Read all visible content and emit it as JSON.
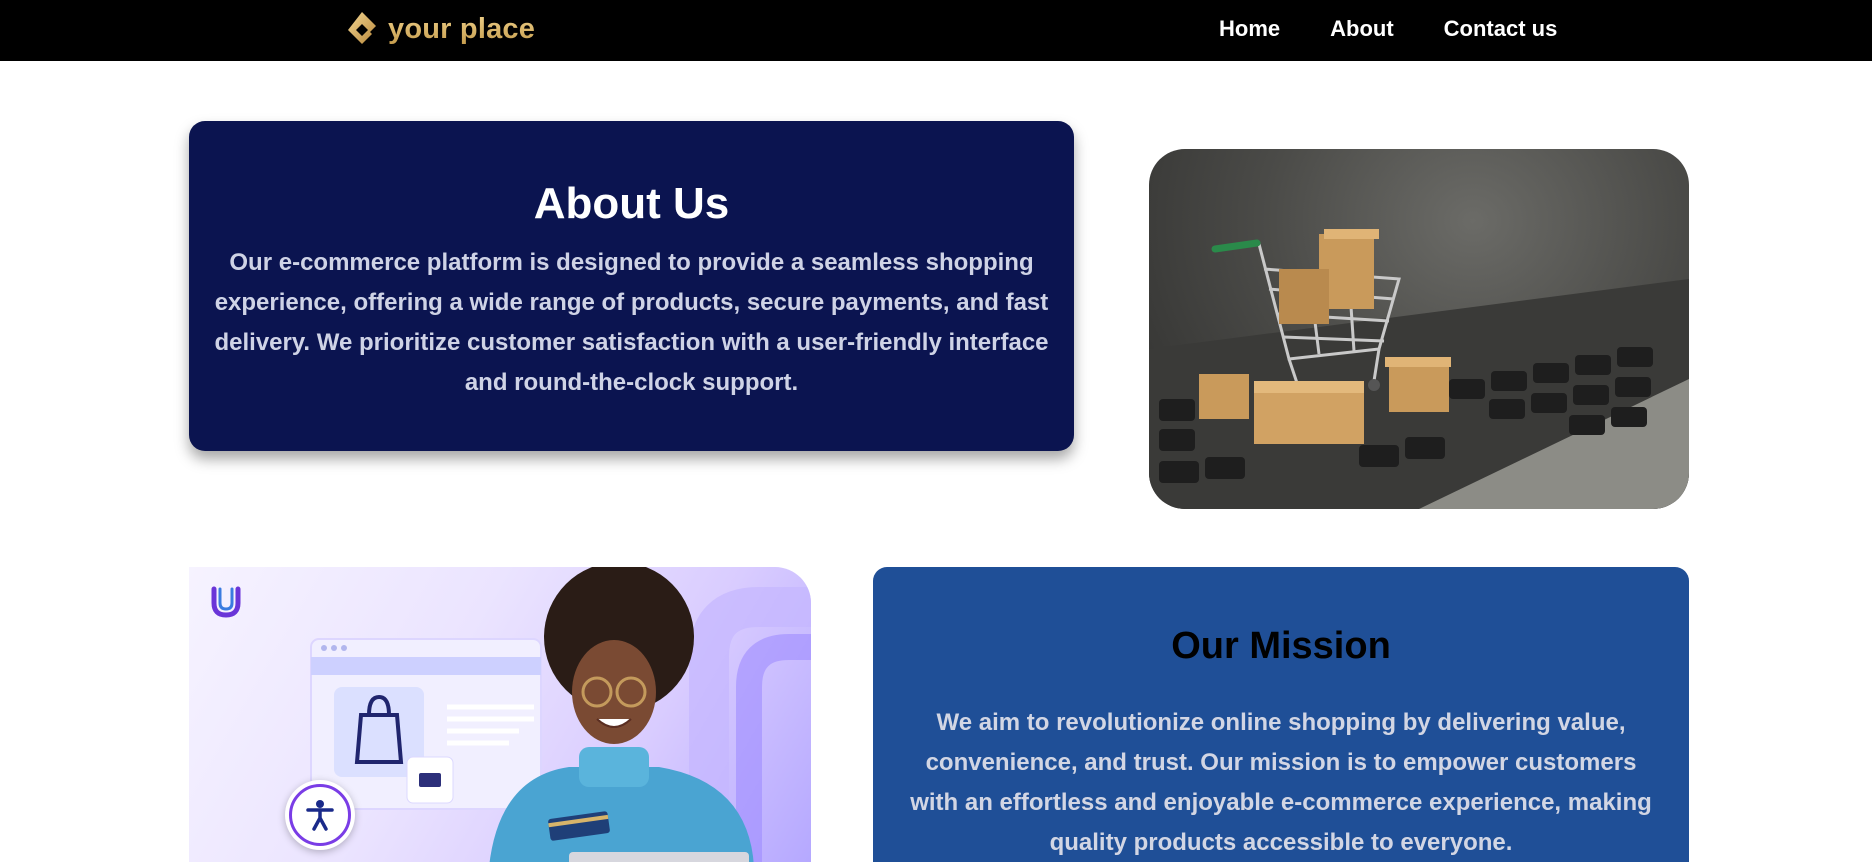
{
  "navbar": {
    "logo_text": "your place",
    "links": [
      {
        "label": "Home"
      },
      {
        "label": "About"
      },
      {
        "label": "Contact us"
      }
    ]
  },
  "about": {
    "title": "About Us",
    "body": "Our e-commerce platform is designed to provide a seamless shopping experience, offering a wide range of products, secure payments, and fast delivery. We prioritize customer satisfaction with a user-friendly interface and round-the-clock support."
  },
  "mission": {
    "title": "Our Mission",
    "body": "We aim to revolutionize online shopping by delivering value, convenience, and trust. Our mission is to empower customers with an effortless and enjoyable e-commerce experience, making quality products accessible to everyone."
  },
  "colors": {
    "navbar_bg": "#000000",
    "logo_gold": "#d9b56c",
    "about_card_bg": "#0b1450",
    "mission_card_bg": "#1f4f97"
  },
  "icons": {
    "logo": "diamond-logo-icon",
    "accessibility": "accessibility-icon",
    "brand_badge": "u-logo-icon"
  }
}
